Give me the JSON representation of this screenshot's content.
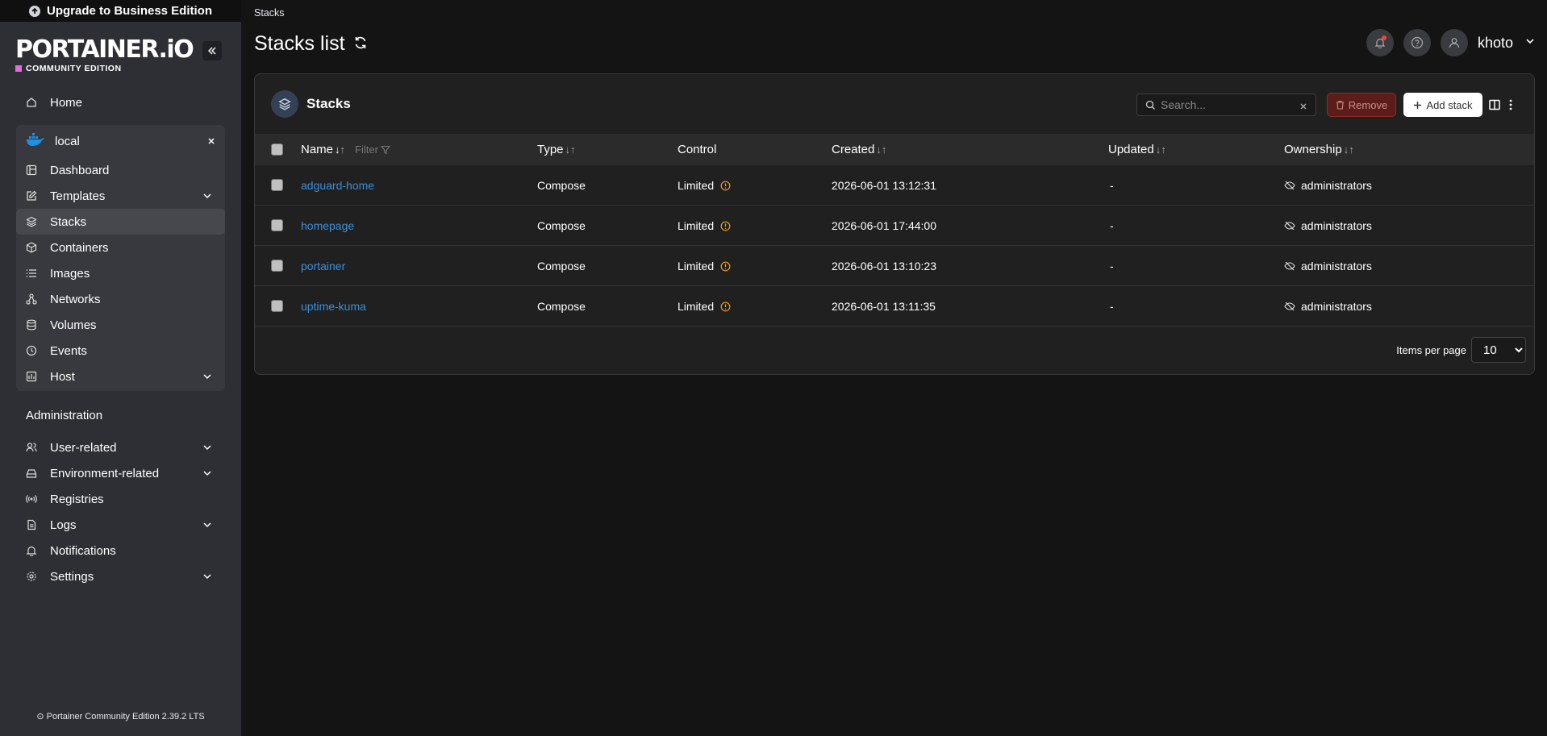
{
  "upgrade_label": "Upgrade to Business Edition",
  "brand": {
    "logo": "PORTAINER.iO",
    "edition": "COMMUNITY EDITION",
    "edition_color": "#e56ae0"
  },
  "nav": {
    "home": "Home"
  },
  "environment": {
    "name": "local",
    "items": [
      {
        "label": "Dashboard",
        "icon": "dashboard-icon",
        "chevron": false
      },
      {
        "label": "Templates",
        "icon": "edit-icon",
        "chevron": true
      },
      {
        "label": "Stacks",
        "icon": "layers-icon",
        "chevron": false,
        "active": true
      },
      {
        "label": "Containers",
        "icon": "box-icon",
        "chevron": false
      },
      {
        "label": "Images",
        "icon": "list-icon",
        "chevron": false
      },
      {
        "label": "Networks",
        "icon": "network-icon",
        "chevron": false
      },
      {
        "label": "Volumes",
        "icon": "database-icon",
        "chevron": false
      },
      {
        "label": "Events",
        "icon": "clock-icon",
        "chevron": false
      },
      {
        "label": "Host",
        "icon": "host-icon",
        "chevron": true
      }
    ]
  },
  "administration": {
    "title": "Administration",
    "items": [
      {
        "label": "User-related",
        "chevron": true
      },
      {
        "label": "Environment-related",
        "chevron": true
      },
      {
        "label": "Registries",
        "chevron": false
      },
      {
        "label": "Logs",
        "chevron": true
      },
      {
        "label": "Notifications",
        "chevron": false
      },
      {
        "label": "Settings",
        "chevron": true
      }
    ]
  },
  "footer": "Portainer Community Edition  2.39.2 LTS",
  "breadcrumb": "Stacks",
  "page_title": "Stacks list",
  "user": {
    "name": "khoto"
  },
  "card": {
    "title": "Stacks",
    "search_placeholder": "Search...",
    "remove_label": "Remove",
    "add_label": "Add stack",
    "columns": {
      "name": "Name",
      "filter": "Filter",
      "type": "Type",
      "control": "Control",
      "created": "Created",
      "updated": "Updated",
      "ownership": "Ownership"
    },
    "rows": [
      {
        "name": "adguard-home",
        "type": "Compose",
        "control": "Limited",
        "created": "2026-06-01 13:12:31",
        "updated": "-",
        "ownership": "administrators"
      },
      {
        "name": "homepage",
        "type": "Compose",
        "control": "Limited",
        "created": "2026-06-01 17:44:00",
        "updated": "-",
        "ownership": "administrators"
      },
      {
        "name": "portainer",
        "type": "Compose",
        "control": "Limited",
        "created": "2026-06-01 13:10:23",
        "updated": "-",
        "ownership": "administrators"
      },
      {
        "name": "uptime-kuma",
        "type": "Compose",
        "control": "Limited",
        "created": "2026-06-01 13:11:35",
        "updated": "-",
        "ownership": "administrators"
      }
    ],
    "items_per_page_label": "Items per page",
    "items_per_page_value": "10"
  },
  "colors": {
    "link": "#3b8fd9",
    "warning": "#f59e0b",
    "sidebar_bg": "#2d2f34",
    "page_bg": "#141414"
  }
}
